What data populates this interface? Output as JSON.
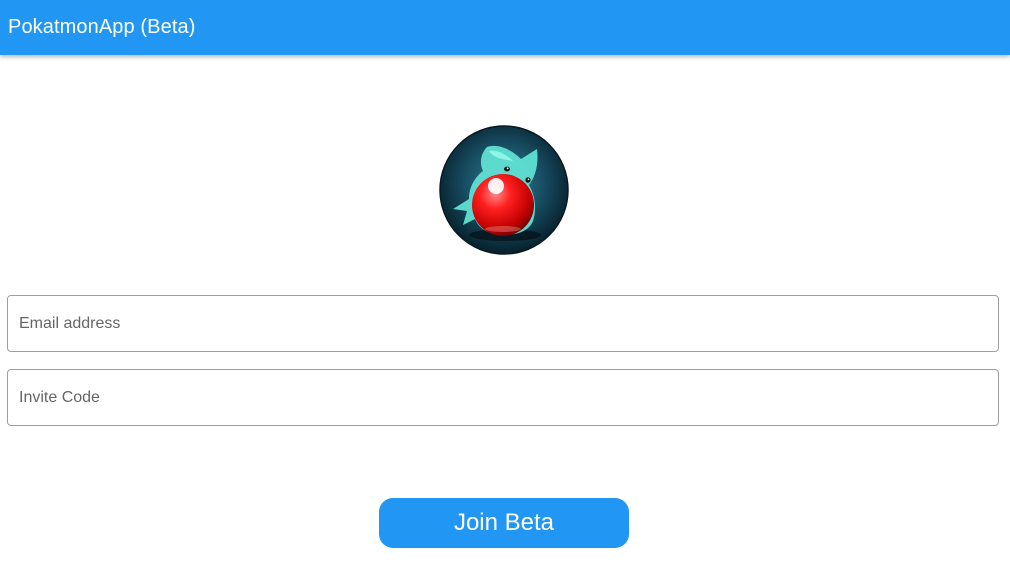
{
  "app_bar": {
    "title": "PokatmonApp (Beta)",
    "color": "#2196F3"
  },
  "logo": {
    "icon": "pokeball-creature-logo-icon"
  },
  "form": {
    "email_placeholder": "Email address",
    "email_value": "",
    "invite_placeholder": "Invite Code",
    "invite_value": "",
    "submit_label": "Join Beta"
  },
  "colors": {
    "primary": "#2196F3",
    "field_border": "#9e9e9e"
  }
}
